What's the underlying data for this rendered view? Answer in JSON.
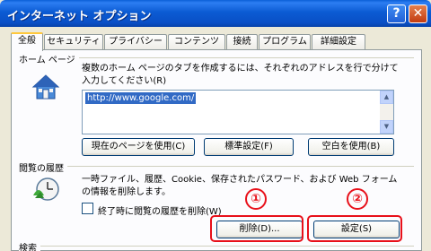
{
  "window": {
    "title": "インターネット オプション",
    "help_label": "?",
    "close_label": "✕"
  },
  "tabs": [
    {
      "label": "全般"
    },
    {
      "label": "セキュリティ"
    },
    {
      "label": "プライバシー"
    },
    {
      "label": "コンテンツ"
    },
    {
      "label": "接続"
    },
    {
      "label": "プログラム"
    },
    {
      "label": "詳細設定"
    }
  ],
  "home_page": {
    "section_label": "ホーム ページ",
    "description_line1": "複数のホーム ページのタブを作成するには、それぞれのアドレスを行で分けて",
    "description_line2": "入力してください(R)",
    "url_value": "http://www.google.com/",
    "buttons": {
      "use_current": "現在のページを使用(C)",
      "use_default": "標準設定(F)",
      "use_blank": "空白を使用(B)"
    }
  },
  "history": {
    "section_label": "閲覧の履歴",
    "description_line1": "一時ファイル、履歴、Cookie、保存されたパスワード、および Web フォーム",
    "description_line2": "の情報を削除します。",
    "checkbox_label": "終了時に閲覧の履歴を削除(W)",
    "delete_button": "削除(D)...",
    "settings_button": "設定(S)"
  },
  "search": {
    "section_label": "検索"
  },
  "annotations": {
    "marker1": "①",
    "marker2": "②"
  },
  "colors": {
    "highlight": "#E8101A",
    "titlebar": "#0A5FD6",
    "selection": "#316AC5"
  }
}
